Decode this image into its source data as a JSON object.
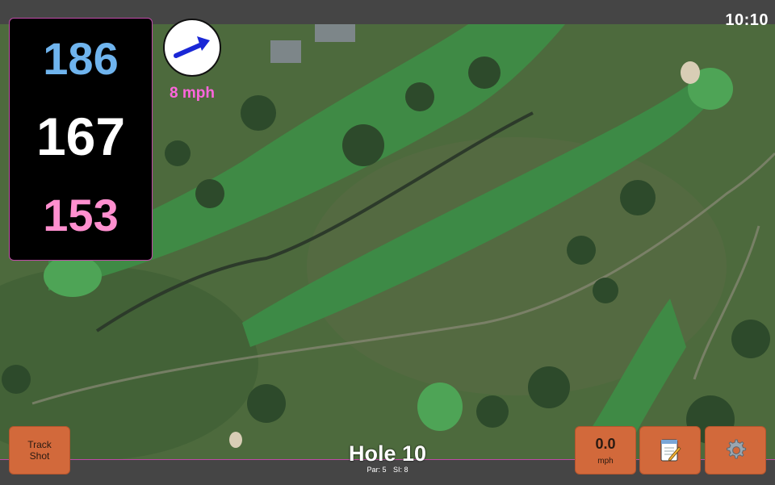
{
  "status": {
    "time": "10:10"
  },
  "yardages": {
    "back": "186",
    "center": "167",
    "front": "153",
    "colors": {
      "back": "#6fb4ee",
      "center": "#ffffff",
      "front": "#ff8fcf"
    }
  },
  "wind": {
    "speed": "8 mph",
    "icon": "arrow-northeast-icon",
    "arrow_color": "#1a27d6",
    "speed_color": "#ff66dd"
  },
  "hole": {
    "title": "Hole 10",
    "par": "Par: 5",
    "si": "SI: 8"
  },
  "buttons": {
    "track_shot": "Track\nShot",
    "speed_value": "0.0",
    "speed_unit": "mph",
    "notes_icon": "notepad-pencil-icon",
    "settings_icon": "gear-icon"
  },
  "colors": {
    "tile": "#d2693b",
    "accent_border": "#c04aa8"
  }
}
